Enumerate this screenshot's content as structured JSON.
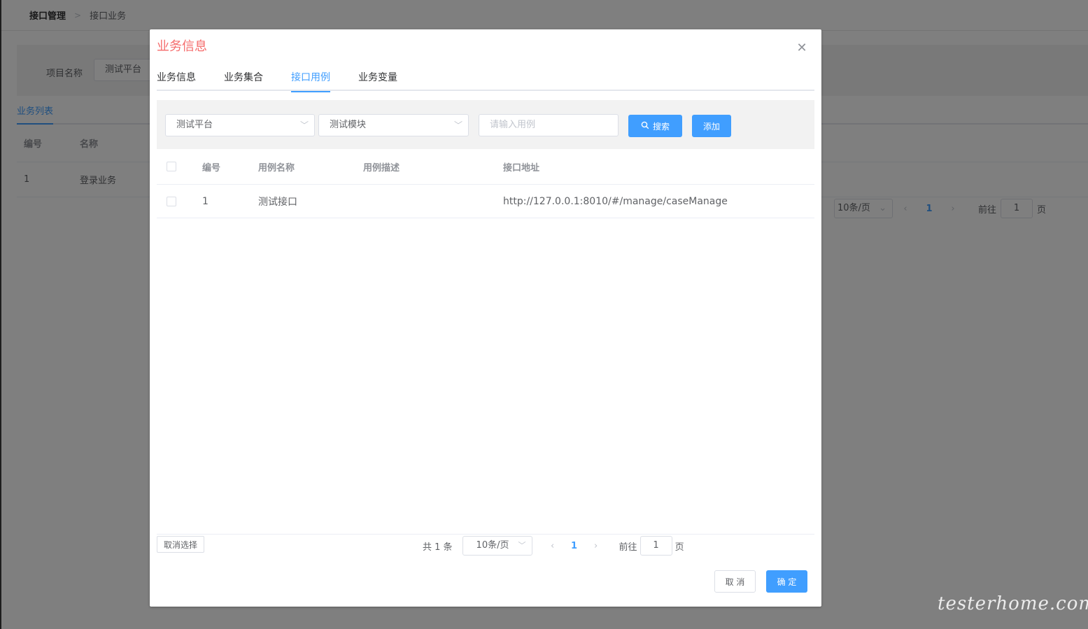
{
  "background": {
    "breadcrumb": {
      "parent": "接口管理",
      "current": "接口业务"
    },
    "filter": {
      "label": "项目名称",
      "value": "测试平台"
    },
    "tab": "业务列表",
    "table": {
      "headers": [
        "编号",
        "名称"
      ],
      "rows": [
        {
          "id": "1",
          "name": "登录业务"
        }
      ]
    },
    "pager": {
      "size": "10条/页",
      "page": "1",
      "goto_label": "前往",
      "goto_value": "1",
      "page_suffix": "页"
    }
  },
  "dialog": {
    "title": "业务信息",
    "tabs": [
      {
        "label": "业务信息",
        "active": false
      },
      {
        "label": "业务集合",
        "active": false
      },
      {
        "label": "接口用例",
        "active": true
      },
      {
        "label": "业务变量",
        "active": false
      }
    ],
    "toolbar": {
      "project_select": "测试平台",
      "module_select": "测试模块",
      "case_input_placeholder": "请输入用例",
      "search_label": "搜索",
      "add_label": "添加"
    },
    "table": {
      "headers": {
        "id": "编号",
        "name": "用例名称",
        "desc": "用例描述",
        "url": "接口地址"
      },
      "rows": [
        {
          "id": "1",
          "name": "测试接口",
          "desc": "",
          "url": "http://127.0.0.1:8010/#/manage/caseManage"
        }
      ]
    },
    "clear_selection": "取消选择",
    "pager": {
      "total": "共 1 条",
      "size": "10条/页",
      "page": "1",
      "goto_label": "前往",
      "goto_value": "1",
      "page_suffix": "页"
    },
    "footer": {
      "cancel": "取 消",
      "ok": "确 定"
    }
  },
  "watermark": "testerhome.com",
  "colors": {
    "primary": "#409eff",
    "title": "#f56c6c"
  }
}
